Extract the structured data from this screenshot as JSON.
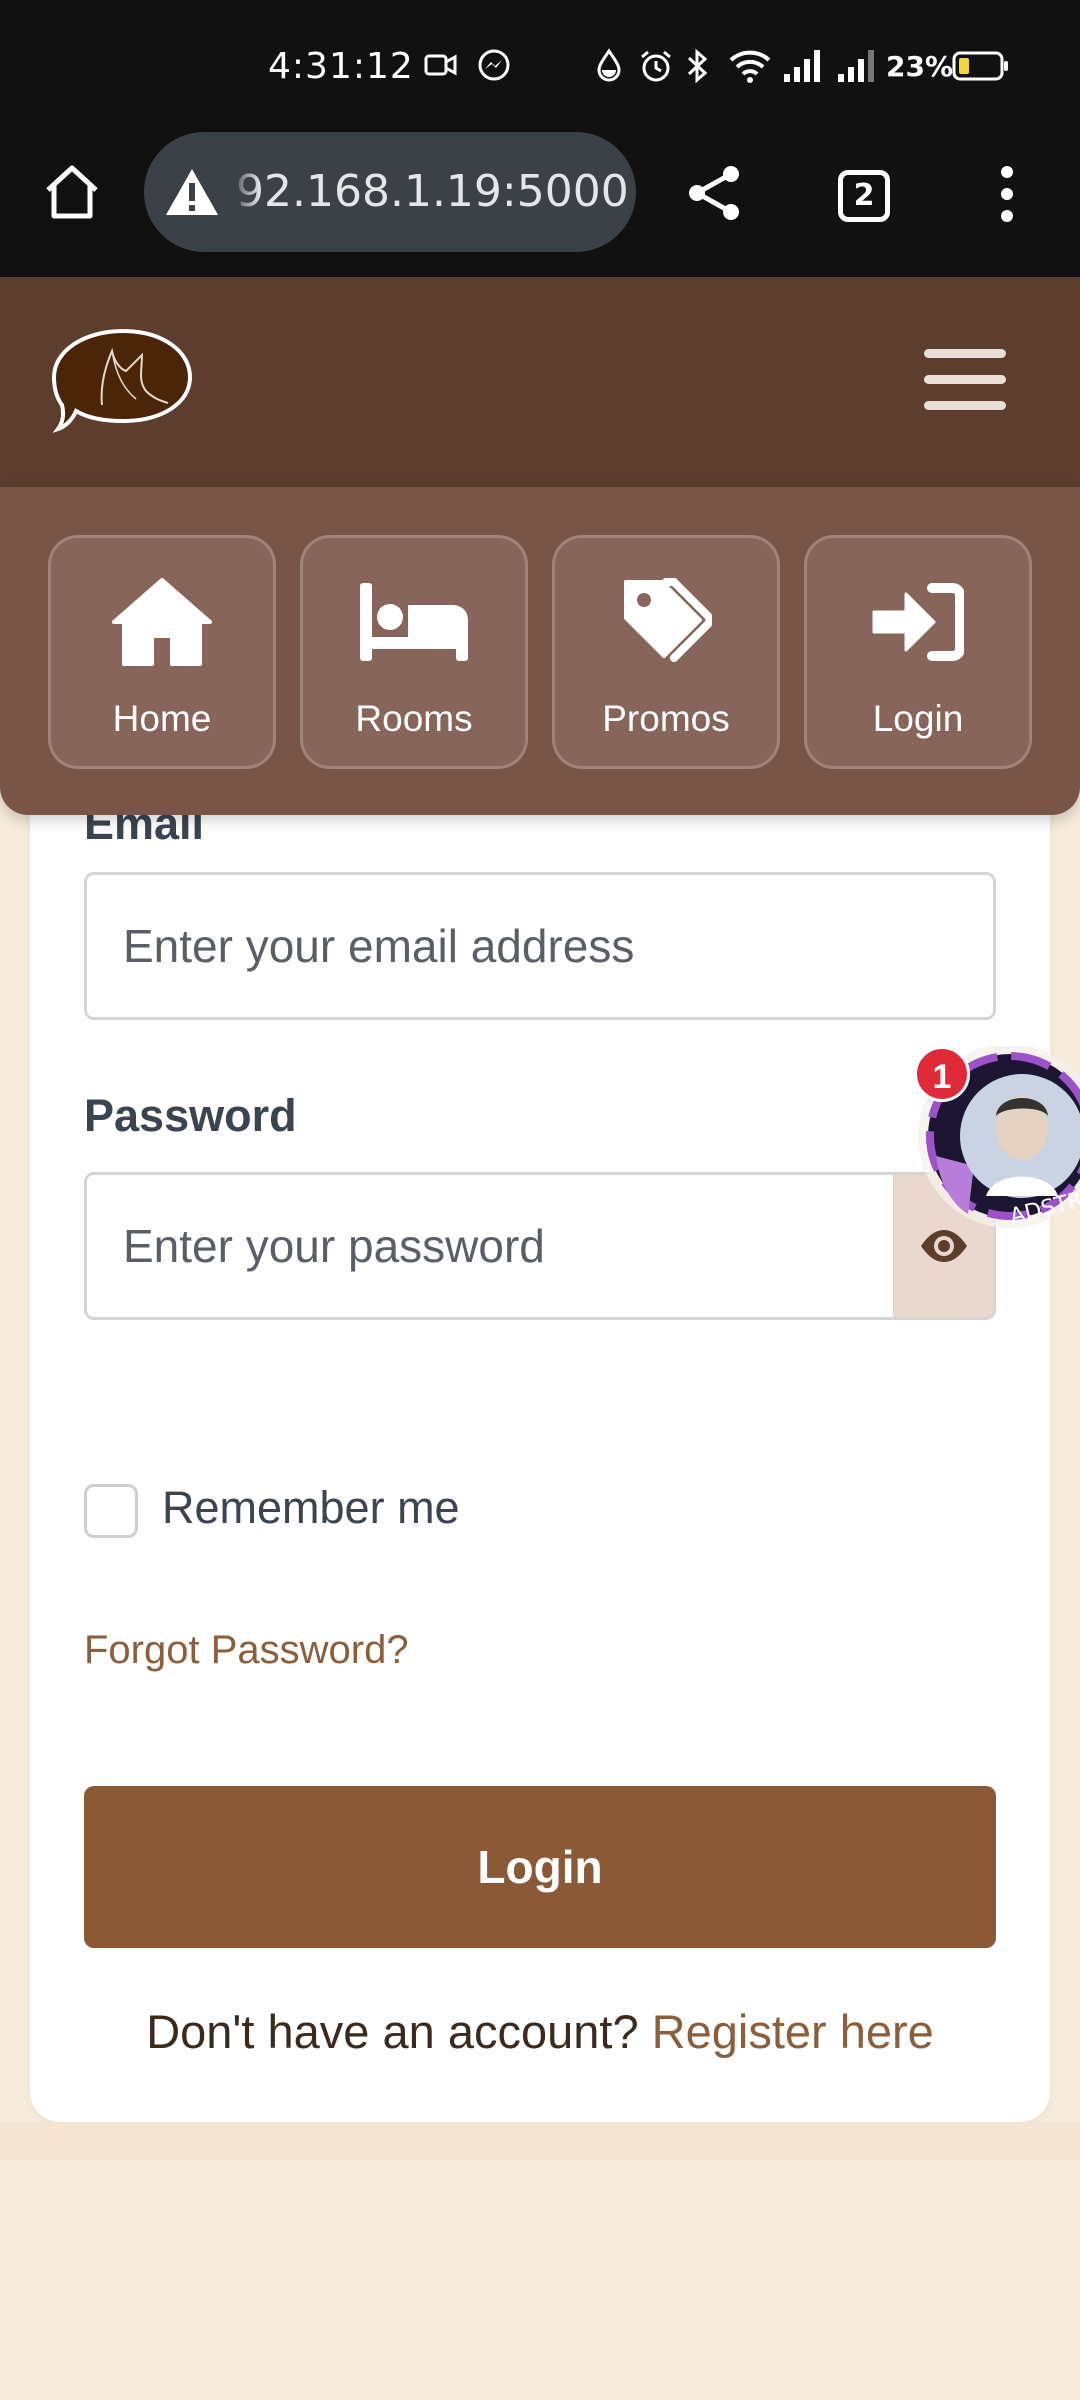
{
  "status_bar": {
    "time": "4:31:12",
    "battery": "23%"
  },
  "browser": {
    "url": "92.168.1.19:5000",
    "tab_count": "2"
  },
  "nav": {
    "items": [
      {
        "label": "Home",
        "icon": "home-icon"
      },
      {
        "label": "Rooms",
        "icon": "bed-icon"
      },
      {
        "label": "Promos",
        "icon": "tags-icon"
      },
      {
        "label": "Login",
        "icon": "sign-in-icon"
      }
    ]
  },
  "form": {
    "email_label": "Email",
    "email_placeholder": "Enter your email address",
    "password_label": "Password",
    "password_placeholder": "Enter your password",
    "remember_label": "Remember me",
    "forgot_label": "Forgot Password?",
    "login_label": "Login",
    "register_prompt": "Don't have an account?",
    "register_link": "Register here"
  },
  "chat_head": {
    "badge": "1"
  },
  "colors": {
    "header": "#5c3d2e",
    "nav": "#795548",
    "button": "#8a5a37",
    "link": "#8b5e3c",
    "page_bg": "#f7ebdb"
  }
}
